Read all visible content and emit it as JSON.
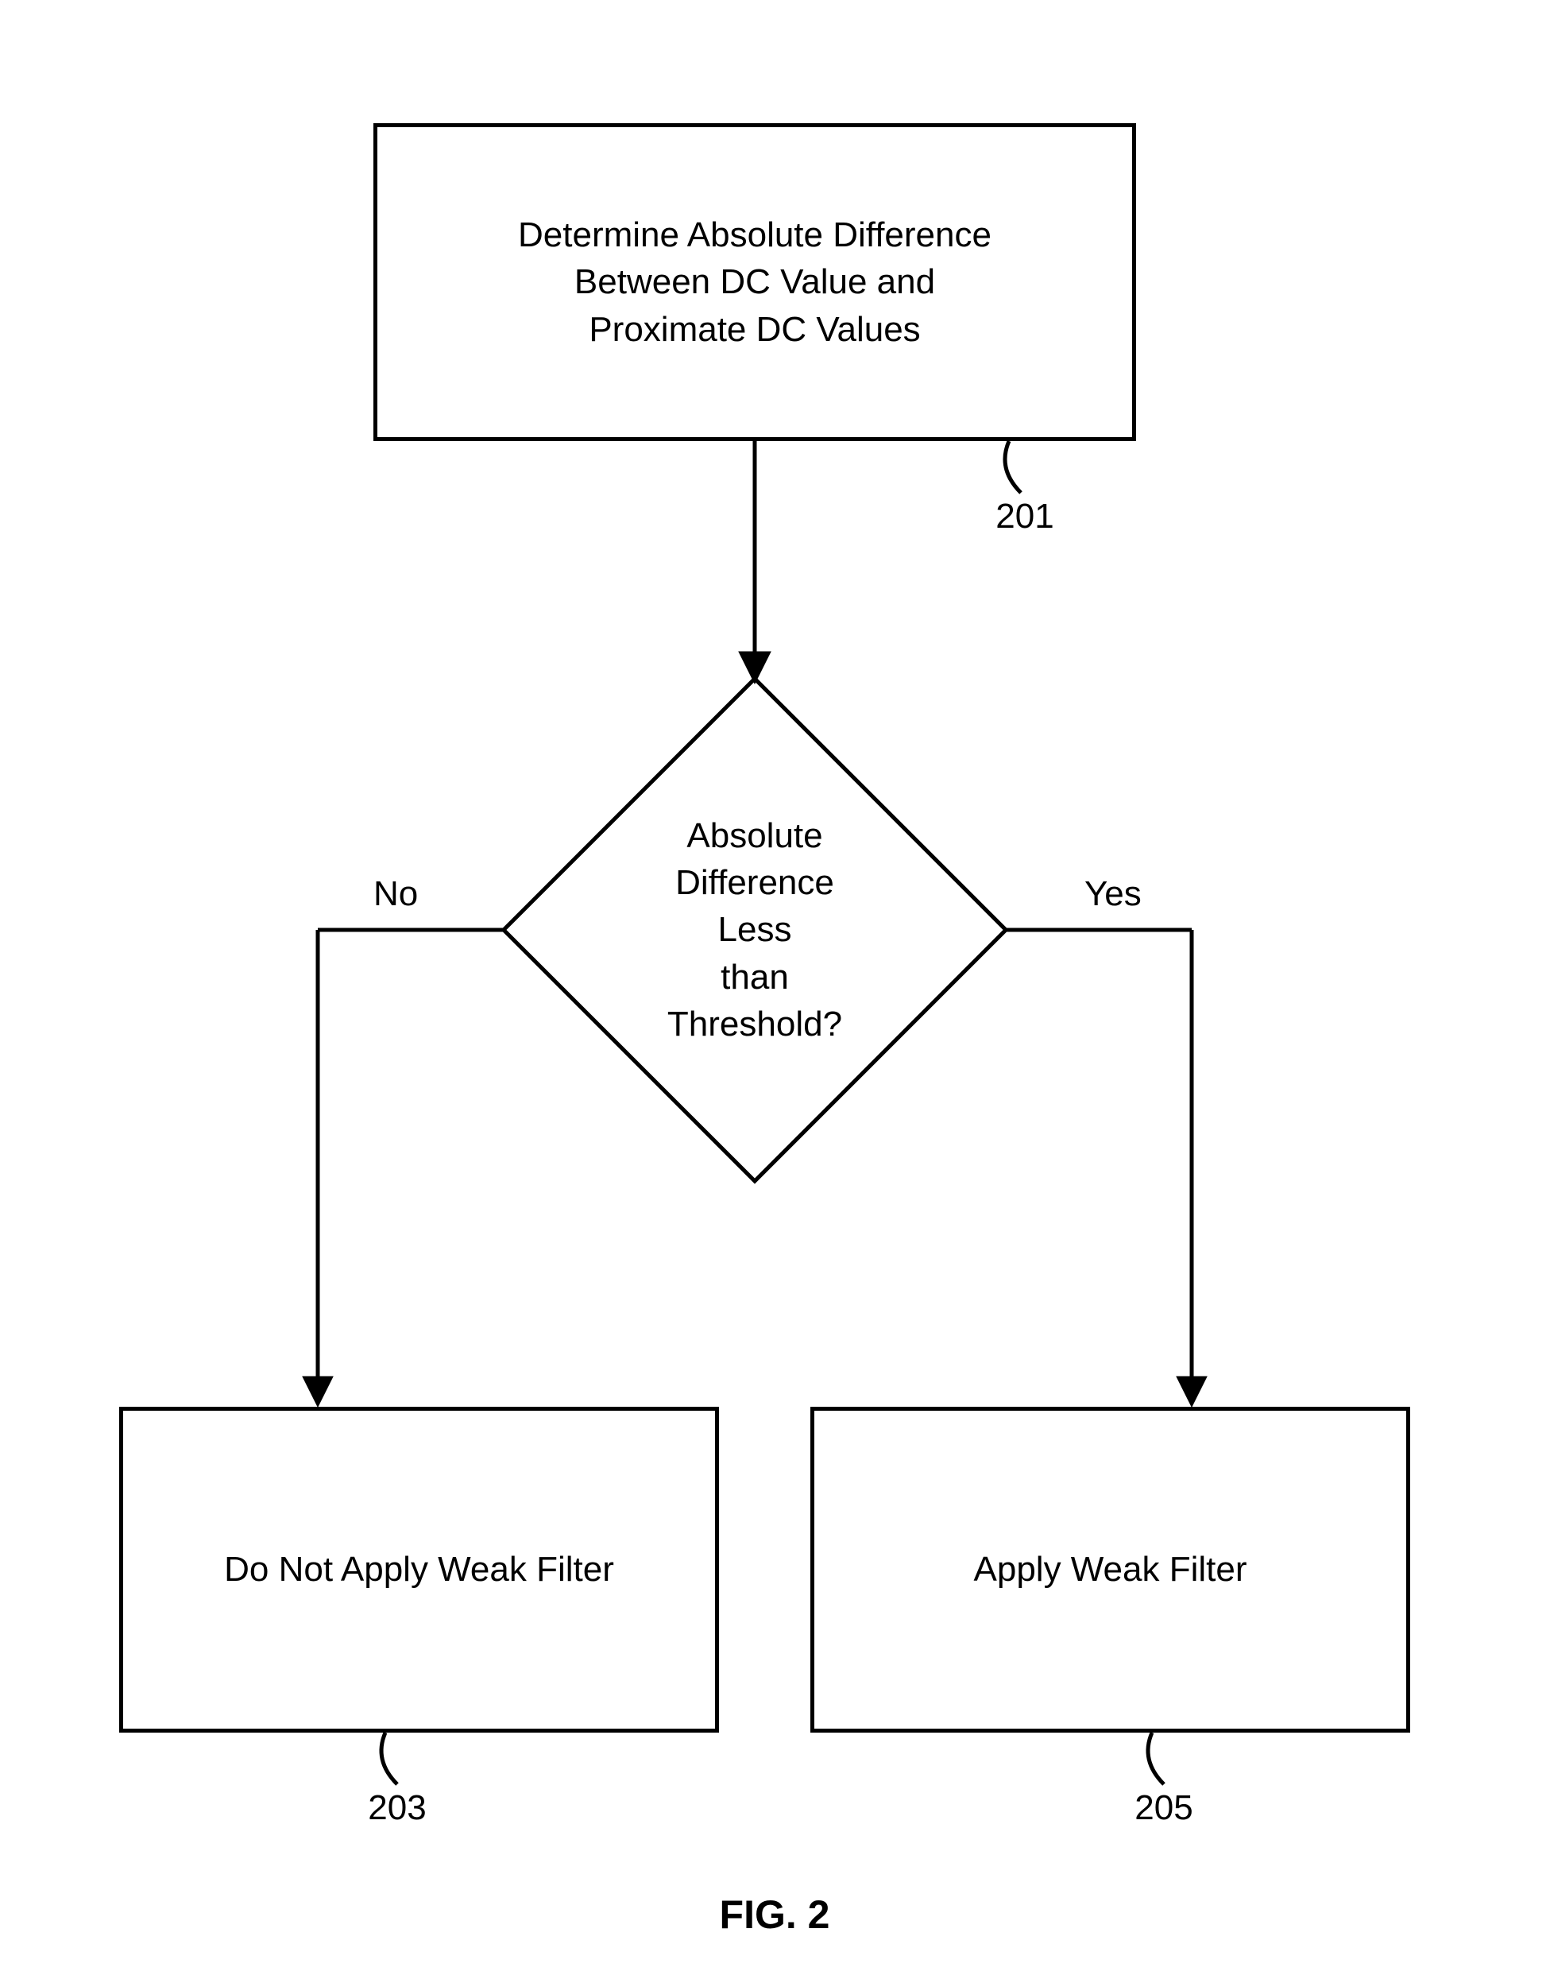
{
  "flow": {
    "step1": {
      "text": "Determine Absolute Difference\nBetween DC Value and\nProximate DC Values",
      "ref": "201"
    },
    "decision": {
      "text": "Absolute\nDifference\nLess\nthan\nThreshold?",
      "no_label": "No",
      "yes_label": "Yes"
    },
    "no_branch": {
      "text": "Do Not Apply Weak Filter",
      "ref": "203"
    },
    "yes_branch": {
      "text": "Apply Weak Filter",
      "ref": "205"
    }
  },
  "figure_caption": "FIG. 2"
}
